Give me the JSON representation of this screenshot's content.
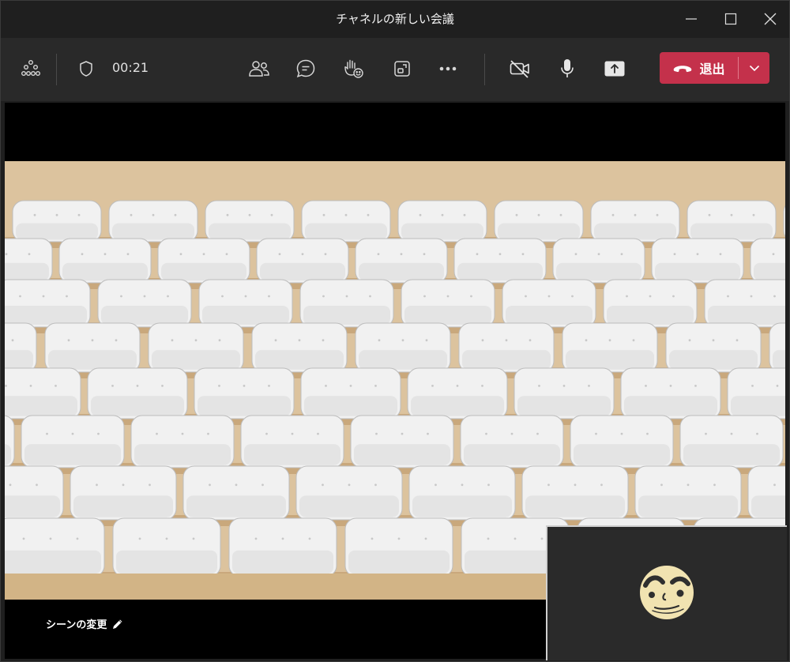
{
  "window": {
    "title": "チャネルの新しい会議"
  },
  "toolbar": {
    "timer": "00:21",
    "leave_label": "退出"
  },
  "stage": {
    "scene_change_label": "シーンの変更"
  },
  "colors": {
    "leave_button": "#c4314b",
    "toolbar_bg": "#292929",
    "title_bg": "#1f1f1f"
  },
  "icons": {
    "apps": "apps-grid-icon",
    "shield": "shield-icon",
    "people": "people-icon",
    "chat": "chat-icon",
    "raise_hand": "raise-hand-icon",
    "view": "view-switch-icon",
    "more": "more-icon",
    "camera_off": "camera-off-icon",
    "mic": "mic-icon",
    "share": "share-screen-icon",
    "phone": "phone-hangup-icon",
    "chevron": "chevron-down-icon",
    "pencil": "pencil-icon"
  }
}
